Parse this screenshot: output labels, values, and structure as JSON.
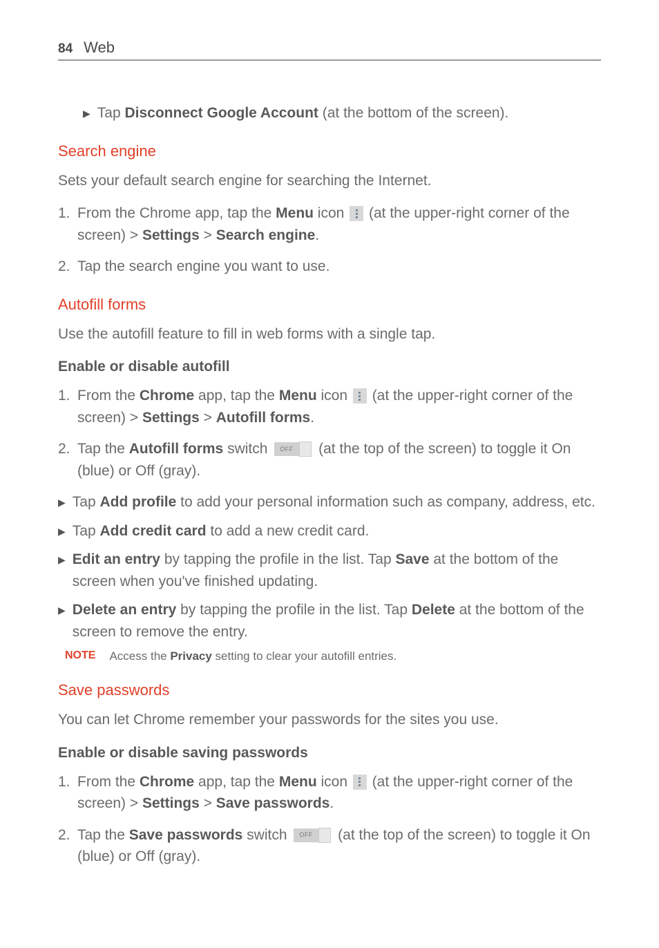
{
  "header": {
    "pageNum": "84",
    "title": "Web"
  },
  "topBullet": {
    "pre": "Tap ",
    "bold": "Disconnect Google Account",
    "post": " (at the bottom of the screen)."
  },
  "searchEngine": {
    "heading": "Search engine",
    "desc": "Sets your default search engine for searching the Internet.",
    "step1": {
      "pre": "From the Chrome app, tap the ",
      "menu": "Menu",
      "iconWord": " icon ",
      "post1": " (at the upper-right corner of the screen) > ",
      "settings": "Settings",
      "gt": " > ",
      "se": "Search engine",
      "period": "."
    },
    "step2": "Tap the search engine you want to use."
  },
  "autofill": {
    "heading": "Autofill forms",
    "desc": "Use the autofill feature to fill in web forms with a single tap.",
    "sub": "Enable or disable autofill",
    "step1": {
      "pre": "From the ",
      "chrome": "Chrome",
      "mid1": " app, tap the ",
      "menu": "Menu",
      "iconWord": " icon ",
      "post1": " (at the upper-right corner of the screen) > ",
      "settings": "Settings",
      "gt": " > ",
      "af": "Autofill forms",
      "period": "."
    },
    "step2": {
      "pre": "Tap the ",
      "af": "Autofill forms",
      "mid": " switch ",
      "post": " (at the top of the screen) to toggle it On (blue) or Off (gray)."
    },
    "b1": {
      "pre": "Tap ",
      "bold": "Add profile",
      "post": " to add your personal information such as company, address, etc."
    },
    "b2": {
      "pre": "Tap ",
      "bold": "Add credit card",
      "post": " to add a new credit card."
    },
    "b3": {
      "bold1": "Edit an entry",
      "mid": " by tapping the profile in the list. Tap ",
      "bold2": "Save",
      "post": " at the bottom of the screen when you've finished updating."
    },
    "b4": {
      "bold1": "Delete an entry",
      "mid": " by tapping the profile in the list. Tap ",
      "bold2": "Delete",
      "post": " at the bottom of the screen to remove the entry."
    },
    "note": {
      "label": "NOTE",
      "pre": "Access the ",
      "bold": "Privacy",
      "post": " setting to clear your autofill entries."
    }
  },
  "savePw": {
    "heading": "Save passwords",
    "desc": "You can let Chrome remember your passwords for the sites you use.",
    "sub": "Enable or disable saving passwords",
    "step1": {
      "pre": "From the ",
      "chrome": "Chrome",
      "mid1": " app, tap the ",
      "menu": "Menu",
      "iconWord": " icon ",
      "post1": " (at the upper-right corner of the screen) > ",
      "settings": "Settings",
      "gt": " > ",
      "sp": "Save passwords",
      "period": "."
    },
    "step2": {
      "pre": "Tap the ",
      "sp": "Save passwords",
      "mid": " switch ",
      "post": " (at the top of the screen) to toggle it On (blue) or Off (gray)."
    }
  },
  "switchText": "OFF"
}
